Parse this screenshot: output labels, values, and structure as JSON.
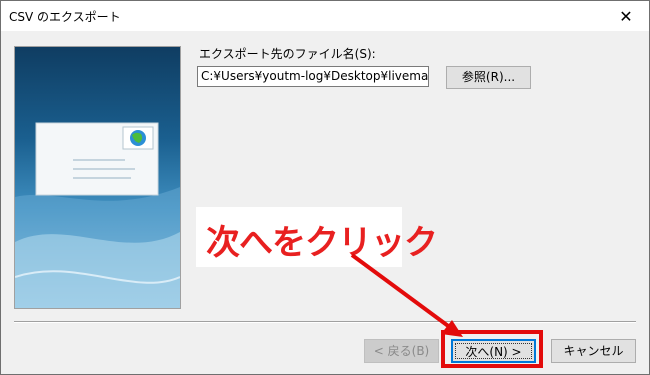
{
  "window": {
    "title": "CSV のエクスポート",
    "close_glyph": "✕"
  },
  "form": {
    "export_label": "エクスポート先のファイル名(S):",
    "file_path": "C:¥Users¥youtm-log¥Desktop¥livemail.",
    "browse_label": "参照(R)..."
  },
  "buttons": {
    "back_label": "< 戻る(B)",
    "next_label": "次へ(N) >",
    "cancel_label": "キャンセル"
  },
  "annotation": {
    "text": "次へをクリック",
    "color": "#e82020"
  }
}
